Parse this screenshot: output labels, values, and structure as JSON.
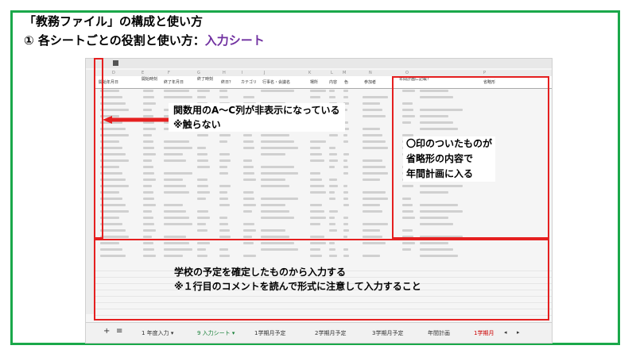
{
  "slide": {
    "title_line1": "「教務ファイル」の構成と使い方",
    "title_line2_prefix": "①  各シートごとの役割と使い方：",
    "title_line2_accent": "入力シート",
    "accent_color": "#7030a0",
    "frame_color": "#1aa84a",
    "highlight_color": "#e52020"
  },
  "sheet": {
    "column_letters": [
      "D",
      "E",
      "F",
      "G",
      "H",
      "I",
      "J",
      "K",
      "L",
      "M",
      "N",
      "O",
      "P"
    ],
    "headers": [
      "開始年月日",
      "開始時刻",
      "終了年月日",
      "終了時刻",
      "終日？",
      "カテゴリ",
      "行事名・会議名",
      "場所",
      "内容",
      "色",
      "参加者",
      "年間計画に記載？",
      "省略形"
    ],
    "tabs": [
      "1 年度入力",
      "9 入力シート",
      "1学期月予定",
      "2学期月予定",
      "3学期月予定",
      "年間計画",
      "1学期月"
    ],
    "tab_controls": {
      "add": "+",
      "list": "≡"
    }
  },
  "callouts": {
    "hidden_columns": "関数用のA〜C列が非表示になっている",
    "hidden_columns_note": "※触らない",
    "marked_line1": "〇印のついたものが",
    "marked_line2": "省略形の内容で",
    "marked_line3": "年間計画に入る",
    "input_line1": "学校の予定を確定したものから入力する",
    "input_line2": "※１行目のコメントを読んで形式に注意して入力すること"
  },
  "icons": {
    "arrow": "left-arrow-icon"
  }
}
